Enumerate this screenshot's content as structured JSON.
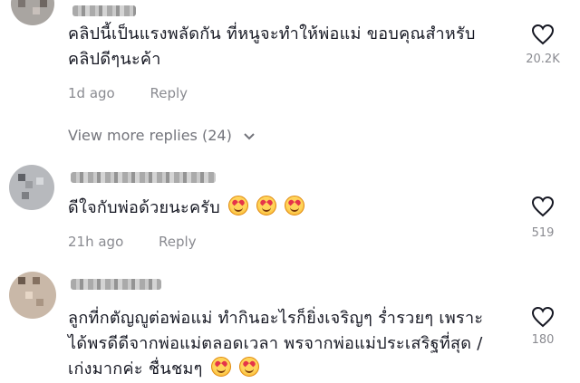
{
  "comments": [
    {
      "text_lines": [
        "คลิปนี้เป็นแรงพลัดกัน ที่หนูจะทำให้พ่อแม่ ขอบคุณสำหรับ",
        "คลิปดีๆนะค้า"
      ],
      "time": "1d ago",
      "reply_label": "Reply",
      "likes": "20.2K",
      "emojis": []
    },
    {
      "text_lines": [
        "ดีใจกับพ่อด้วยนะครับ"
      ],
      "time": "21h ago",
      "reply_label": "Reply",
      "likes": "519",
      "emojis": [
        "smiling-face-with-hearts",
        "smiling-face-with-hearts",
        "smiling-face-with-hearts"
      ]
    },
    {
      "text_lines": [
        "ลูกที่กตัญญูต่อพ่อแม่ ทำกินอะไรก็ยิ่งเจริญๆ ร่ำรวยๆ เพราะ",
        "ได้พรดีดีจากพ่อแม่ตลอดเวลา พรจากพ่อแม่ประเสริฐที่สุด /",
        "เก่งมากค่ะ ชื่นชมๆ"
      ],
      "likes": "180",
      "emojis": [
        "smiling-face-with-hearts",
        "smiling-face-with-hearts"
      ]
    }
  ],
  "view_more_replies": "View more replies (24)",
  "colors": {
    "text": "#161823",
    "meta": "#8a8b91",
    "accent": "#e5344a"
  },
  "icons": {
    "like": "heart-outline-icon",
    "expand": "chevron-down-icon"
  }
}
